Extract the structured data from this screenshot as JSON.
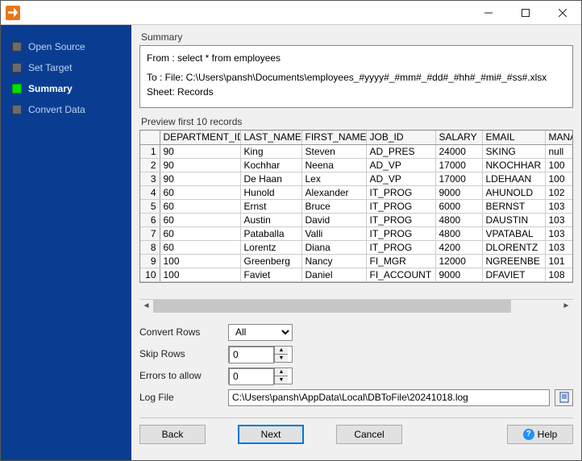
{
  "window": {
    "title": ""
  },
  "sidebar": {
    "items": [
      {
        "label": "Open Source",
        "active": false
      },
      {
        "label": "Set Target",
        "active": false
      },
      {
        "label": "Summary",
        "active": true
      },
      {
        "label": "Convert Data",
        "active": false
      }
    ]
  },
  "summary": {
    "heading": "Summary",
    "from": "From : select * from employees",
    "to": "To : File: C:\\Users\\pansh\\Documents\\employees_#yyyy#_#mm#_#dd#_#hh#_#mi#_#ss#.xlsx Sheet: Records"
  },
  "preview": {
    "heading": "Preview first 10 records",
    "columns": [
      "DEPARTMENT_ID",
      "LAST_NAME",
      "FIRST_NAME",
      "JOB_ID",
      "SALARY",
      "EMAIL",
      "MANAG"
    ],
    "rows": [
      [
        "90",
        "King",
        "Steven",
        "AD_PRES",
        "24000",
        "SKING",
        "null"
      ],
      [
        "90",
        "Kochhar",
        "Neena",
        "AD_VP",
        "17000",
        "NKOCHHAR",
        "100"
      ],
      [
        "90",
        "De Haan",
        "Lex",
        "AD_VP",
        "17000",
        "LDEHAAN",
        "100"
      ],
      [
        "60",
        "Hunold",
        "Alexander",
        "IT_PROG",
        "9000",
        "AHUNOLD",
        "102"
      ],
      [
        "60",
        "Ernst",
        "Bruce",
        "IT_PROG",
        "6000",
        "BERNST",
        "103"
      ],
      [
        "60",
        "Austin",
        "David",
        "IT_PROG",
        "4800",
        "DAUSTIN",
        "103"
      ],
      [
        "60",
        "Pataballa",
        "Valli",
        "IT_PROG",
        "4800",
        "VPATABAL",
        "103"
      ],
      [
        "60",
        "Lorentz",
        "Diana",
        "IT_PROG",
        "4200",
        "DLORENTZ",
        "103"
      ],
      [
        "100",
        "Greenberg",
        "Nancy",
        "FI_MGR",
        "12000",
        "NGREENBE",
        "101"
      ],
      [
        "100",
        "Faviet",
        "Daniel",
        "FI_ACCOUNT",
        "9000",
        "DFAVIET",
        "108"
      ]
    ]
  },
  "form": {
    "convert_rows": {
      "label": "Convert Rows",
      "value": "All",
      "options": [
        "All"
      ]
    },
    "skip_rows": {
      "label": "Skip Rows",
      "value": "0"
    },
    "errors_to_allow": {
      "label": "Errors to allow",
      "value": "0"
    },
    "log_file": {
      "label": "Log File",
      "value": "C:\\Users\\pansh\\AppData\\Local\\DBToFile\\20241018.log"
    }
  },
  "buttons": {
    "back": "Back",
    "next": "Next",
    "cancel": "Cancel",
    "help": "Help"
  }
}
